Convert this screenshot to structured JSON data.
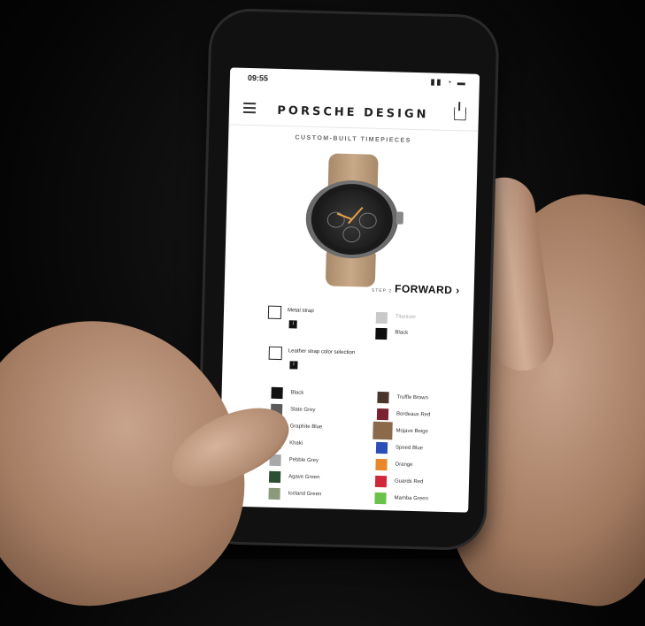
{
  "status": {
    "time": "09:55",
    "icons": "▮▮ ◔ ▬"
  },
  "header": {
    "brand": "PORSCHE DESIGN"
  },
  "subtitle": "CUSTOM-BUILT TIMEPIECES",
  "forward": {
    "prefix": "STEP 2",
    "label": "FORWARD"
  },
  "options": {
    "metal_strap": {
      "label": "Metal strap",
      "info": "i"
    },
    "metal_colors": [
      {
        "label": "Titanium",
        "color": "#c9c9c9"
      },
      {
        "label": "Black",
        "color": "#0d0d0d"
      }
    ],
    "leather_strap": {
      "label": "Leather strap color selection",
      "info": "i"
    }
  },
  "swatches_left": [
    {
      "label": "Black",
      "color": "#111111"
    },
    {
      "label": "Slate Grey",
      "color": "#5a5a5a"
    },
    {
      "label": "Graphite Blue",
      "color": "#2f4157"
    },
    {
      "label": "Khaki",
      "color": "#c8c8c8"
    },
    {
      "label": "Pebble Grey",
      "color": "#a9a9a9"
    },
    {
      "label": "Agave Green",
      "color": "#2a4f32"
    },
    {
      "label": "Iceland Green",
      "color": "#8b9a7a"
    }
  ],
  "swatches_right": [
    {
      "label": "Truffle Brown",
      "color": "#4a352b"
    },
    {
      "label": "Bordeaux Red",
      "color": "#7a2230"
    },
    {
      "label": "Mojave Beige",
      "color": "#8a6a4a"
    },
    {
      "label": "Speed Blue",
      "color": "#2a4fb8"
    },
    {
      "label": "Orange",
      "color": "#e8882a"
    },
    {
      "label": "Guards Red",
      "color": "#d0283a"
    },
    {
      "label": "Mamba Green",
      "color": "#6ac24a"
    }
  ]
}
